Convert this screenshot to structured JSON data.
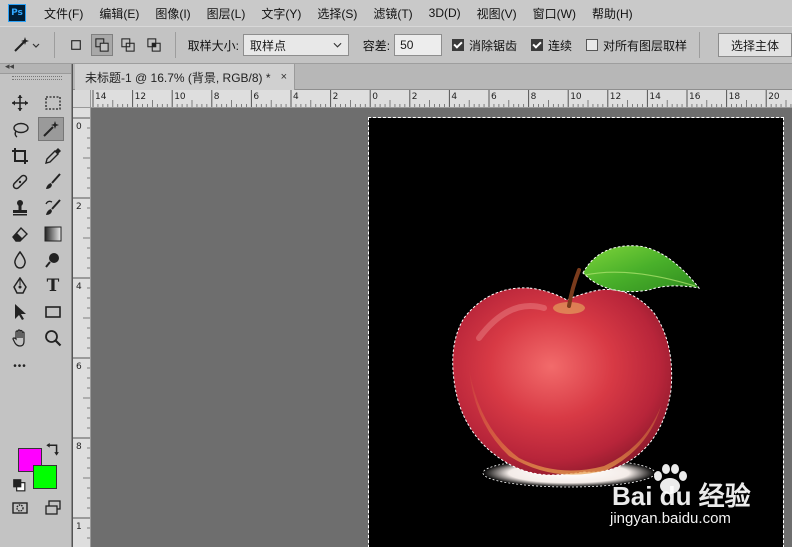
{
  "app": {
    "logo_text": "Ps"
  },
  "menu": [
    "文件(F)",
    "编辑(E)",
    "图像(I)",
    "图层(L)",
    "文字(Y)",
    "选择(S)",
    "滤镜(T)",
    "3D(D)",
    "视图(V)",
    "窗口(W)",
    "帮助(H)"
  ],
  "options": {
    "sample_size_label": "取样大小:",
    "sample_size_value": "取样点",
    "tolerance_label": "容差:",
    "tolerance_value": "50",
    "anti_alias_label": "消除锯齿",
    "anti_alias_checked": true,
    "contiguous_label": "连续",
    "contiguous_checked": true,
    "sample_all_layers_label": "对所有图层取样",
    "sample_all_layers_checked": false,
    "select_subject_label": "选择主体"
  },
  "document": {
    "tab_title": "未标题-1 @ 16.7% (背景, RGB/8) *",
    "close_glyph": "×"
  },
  "toolbar": {
    "collapse_glyph": "◂◂",
    "more_glyph": "•••",
    "foreground_color": "#ff00ff",
    "background_color": "#00ff00",
    "type_glyph": "T"
  },
  "ruler": {
    "horizontal": [
      "14",
      "12",
      "10",
      "8",
      "6",
      "4",
      "2",
      "0",
      "2",
      "4",
      "6",
      "8",
      "10",
      "12",
      "14",
      "16",
      "18",
      "20"
    ],
    "vertical": [
      "0",
      "2",
      "4",
      "6",
      "8",
      "1"
    ]
  },
  "watermark": {
    "brand": "Bai du 经验",
    "url": "jingyan.baidu.com"
  }
}
